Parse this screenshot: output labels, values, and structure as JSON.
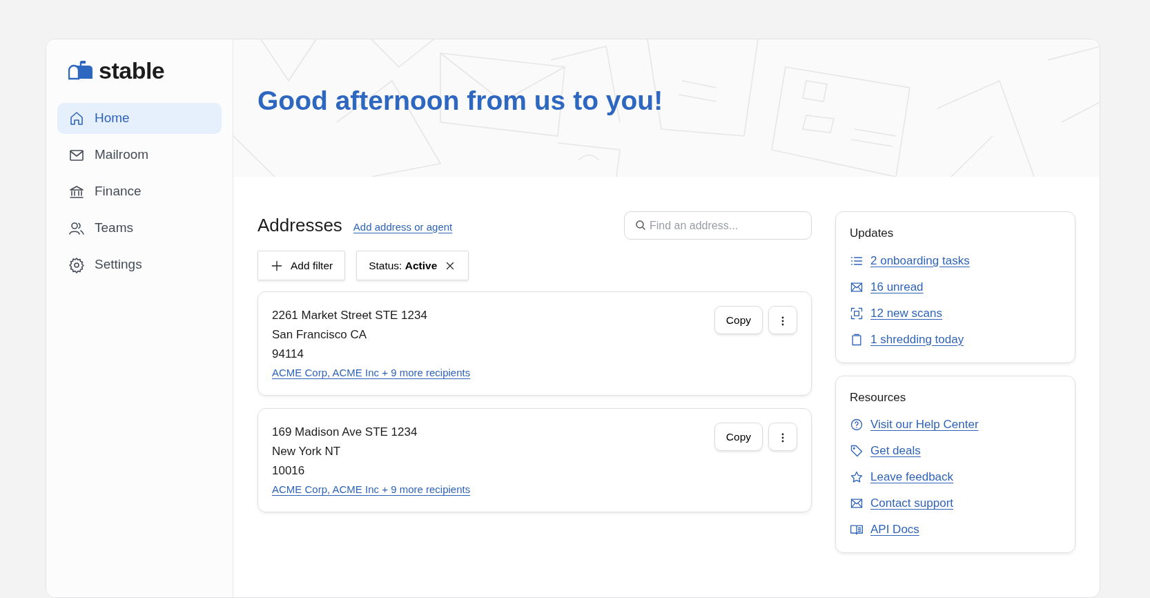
{
  "logo": {
    "text": "stable"
  },
  "sidebar": {
    "items": [
      {
        "label": "Home",
        "selected": true
      },
      {
        "label": "Mailroom",
        "selected": false
      },
      {
        "label": "Finance",
        "selected": false
      },
      {
        "label": "Teams",
        "selected": false
      },
      {
        "label": "Settings",
        "selected": false
      }
    ]
  },
  "greeting": "Good afternoon from us to you!",
  "addresses": {
    "title": "Addresses",
    "add_link": "Add address or agent",
    "search": {
      "placeholder": "Find an address..."
    },
    "add_filter": "Add filter",
    "filter": {
      "label": "Status:",
      "value": "Active"
    },
    "items": [
      {
        "line1": "2261 Market Street STE 1234",
        "line2": "San Francisco CA",
        "line3": "94114",
        "recipients": "ACME Corp, ACME Inc + 9 more recipients",
        "copy": "Copy"
      },
      {
        "line1": "169 Madison Ave STE 1234",
        "line2": "New York NT",
        "line3": "10016",
        "recipients": "ACME Corp, ACME Inc + 9 more recipients",
        "copy": "Copy"
      }
    ]
  },
  "updates": {
    "title": "Updates",
    "links": [
      "2 onboarding tasks",
      "16 unread",
      "12 new scans",
      "1 shredding today"
    ]
  },
  "resources": {
    "title": "Resources",
    "links": [
      "Visit our Help Center",
      "Get deals",
      "Leave feedback",
      "Contact support",
      "API Docs"
    ]
  }
}
